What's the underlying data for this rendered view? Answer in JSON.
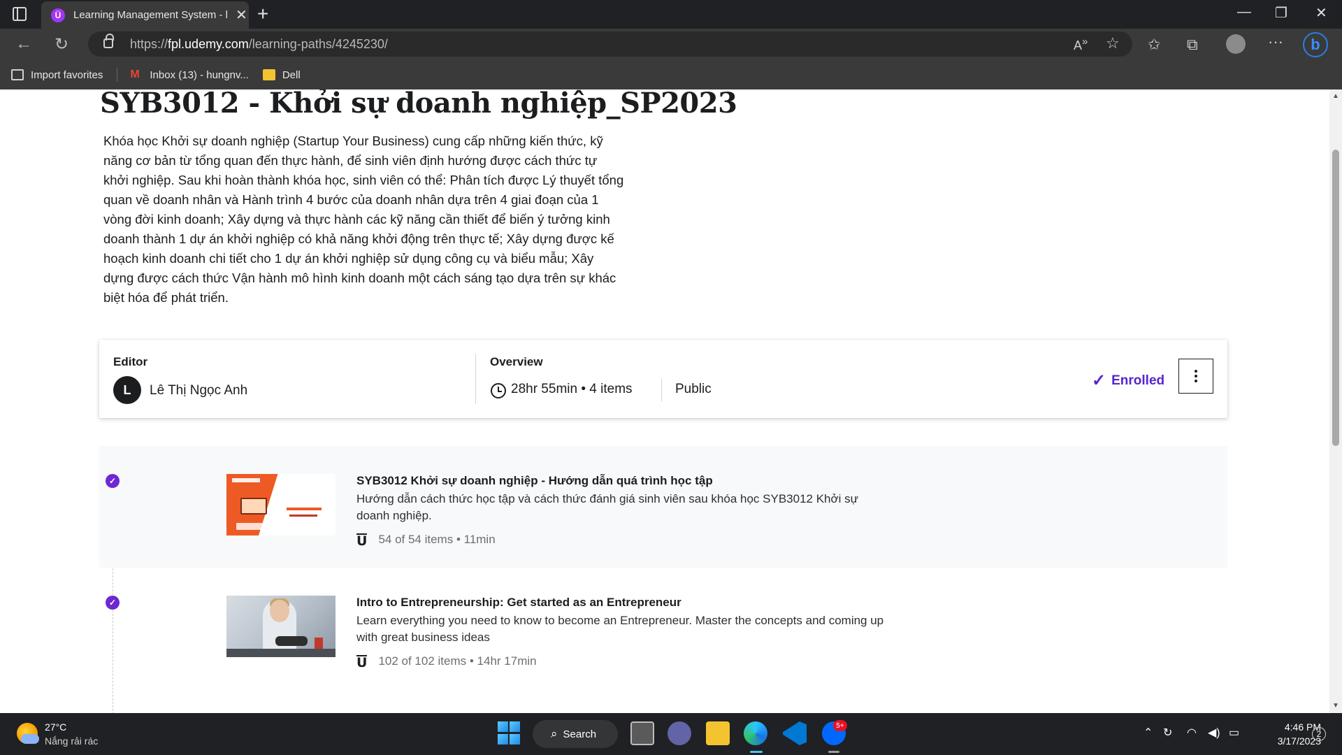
{
  "browser": {
    "tab_title": "Learning Management System - l",
    "tab_favicon": "Ü",
    "url_prefix": "https://",
    "url_host": "fpl.udemy.com",
    "url_path": "/learning-paths/4245230/",
    "favorites": [
      {
        "label": "Import favorites",
        "icon": "import-icon"
      },
      {
        "label": "Inbox (13) - hungnv...",
        "icon": "gmail-icon"
      },
      {
        "label": "Dell",
        "icon": "folder-icon"
      }
    ]
  },
  "page": {
    "title": "SYB3012 - Khởi sự doanh nghiệp_SP2023",
    "description": "Khóa học Khởi sự doanh nghiệp (Startup Your Business) cung cấp những kiến thức, kỹ năng cơ bản từ tổng quan đến thực hành, để sinh viên định hướng được cách thức tự khởi nghiệp. Sau khi hoàn thành khóa học, sinh viên có thể: Phân tích được Lý thuyết tổng quan về doanh nhân và Hành trình 4 bước của doanh nhân dựa trên 4 giai đoạn của 1 vòng đời kinh doanh; Xây dựng và thực hành các kỹ năng cần thiết để biến ý tưởng kinh doanh thành 1 dự án khởi nghiệp có khả năng khởi động trên thực tế; Xây dựng được kế hoạch kinh doanh chi tiết cho 1 dự án khởi nghiệp sử dụng công cụ và biểu mẫu; Xây dựng được cách thức Vận hành mô hình kinh doanh một cách sáng tạo dựa trên sự khác biệt hóa để phát triển."
  },
  "info_card": {
    "editor_label": "Editor",
    "editor_initial": "L",
    "editor_name": "Lê Thị Ngọc Anh",
    "overview_label": "Overview",
    "duration": "28hr 55min",
    "items": "4 items",
    "visibility": "Public",
    "enrolled_label": "Enrolled"
  },
  "items": [
    {
      "title": "SYB3012 Khởi sự doanh nghiệp - Hướng dẫn quá trình học tập",
      "description": "Hướng dẫn cách thức học tập và cách thức đánh giá sinh viên sau khóa học SYB3012 Khởi sự doanh nghiệp.",
      "progress": "54 of 54 items",
      "duration": "11min",
      "completed": true
    },
    {
      "title": "Intro to Entrepreneurship: Get started as an Entrepreneur",
      "description": "Learn everything you need to know to become an Entrepreneur. Master the concepts and coming up with great business ideas",
      "progress": "102 of 102 items",
      "duration": "14hr 17min",
      "completed": true
    }
  ],
  "taskbar": {
    "temperature": "27°C",
    "weather": "Nắng rải rác",
    "search_label": "Search",
    "zalo_badge": "5+",
    "time": "4:46 PM",
    "date": "3/17/2023",
    "notification_count": "2"
  },
  "colors": {
    "accent": "#5624d0",
    "check": "#6d28d2",
    "text": "#1c1d1f"
  }
}
